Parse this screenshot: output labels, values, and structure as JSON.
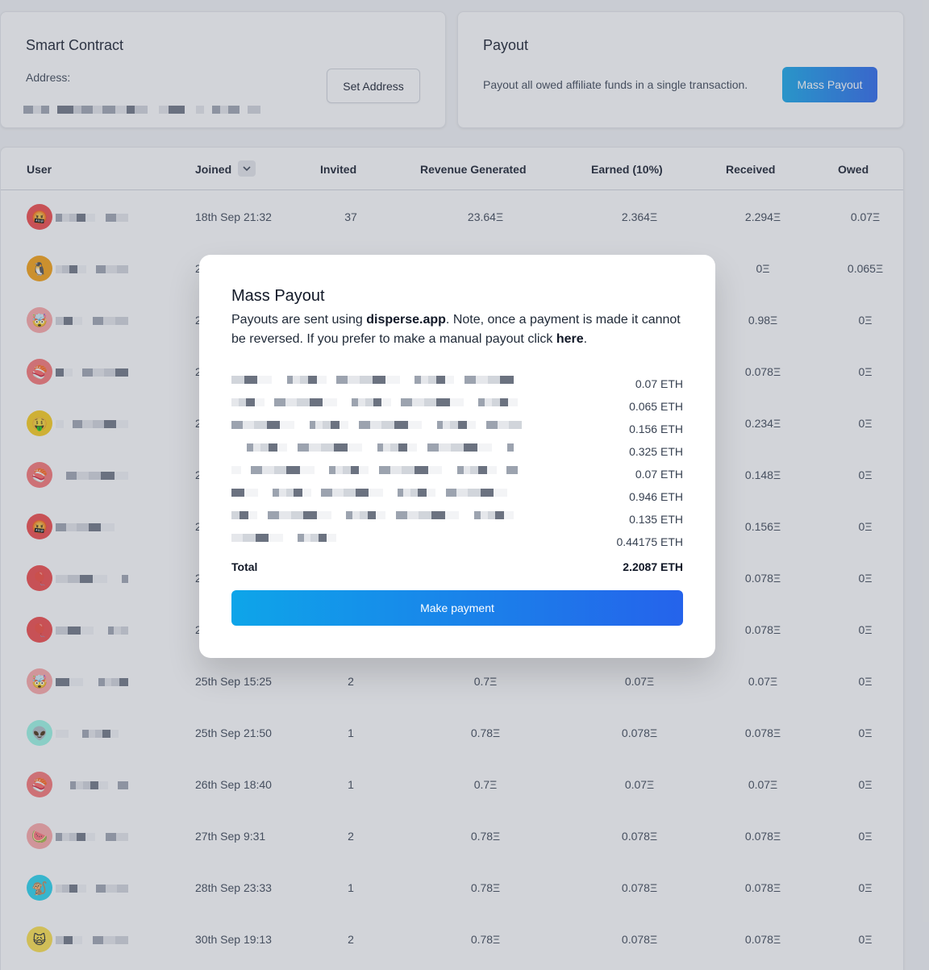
{
  "smart_contract": {
    "title": "Smart Contract",
    "address_label": "Address:",
    "set_address_label": "Set Address"
  },
  "payout": {
    "title": "Payout",
    "description": "Payout all owed affiliate funds in a single transaction.",
    "button_label": "Mass Payout"
  },
  "table": {
    "headers": [
      "User",
      "Joined",
      "Invited",
      "Revenue Generated",
      "Earned (10%)",
      "Received",
      "Owed"
    ],
    "rows": [
      {
        "avatar": "🤬",
        "color": "#ef4444",
        "joined": "18th Sep 21:32",
        "invited": "37",
        "revenue": "23.64Ξ",
        "earned": "2.364Ξ",
        "received": "2.294Ξ",
        "owed": "0.07Ξ"
      },
      {
        "avatar": "🐧",
        "color": "#f59e0b",
        "joined": "2",
        "invited": "",
        "revenue": "",
        "earned": "",
        "received": "0Ξ",
        "owed": "0.065Ξ"
      },
      {
        "avatar": "🤯",
        "color": "#fca5a5",
        "joined": "2",
        "invited": "",
        "revenue": "",
        "earned": "",
        "received": "0.98Ξ",
        "owed": "0Ξ"
      },
      {
        "avatar": "🍣",
        "color": "#f87171",
        "joined": "2",
        "invited": "",
        "revenue": "",
        "earned": "",
        "received": "0.078Ξ",
        "owed": "0Ξ"
      },
      {
        "avatar": "🤑",
        "color": "#facc15",
        "joined": "2",
        "invited": "",
        "revenue": "",
        "earned": "",
        "received": "0.234Ξ",
        "owed": "0Ξ"
      },
      {
        "avatar": "🍣",
        "color": "#f87171",
        "joined": "2",
        "invited": "",
        "revenue": "",
        "earned": "",
        "received": "0.148Ξ",
        "owed": "0Ξ"
      },
      {
        "avatar": "🤬",
        "color": "#ef4444",
        "joined": "2",
        "invited": "",
        "revenue": "",
        "earned": "",
        "received": "0.156Ξ",
        "owed": "0Ξ"
      },
      {
        "avatar": "🎈",
        "color": "#ef4444",
        "joined": "2",
        "invited": "",
        "revenue": "",
        "earned": "",
        "received": "0.078Ξ",
        "owed": "0Ξ"
      },
      {
        "avatar": "🎈",
        "color": "#ef4444",
        "joined": "2",
        "invited": "",
        "revenue": "",
        "earned": "",
        "received": "0.078Ξ",
        "owed": "0Ξ"
      },
      {
        "avatar": "🤯",
        "color": "#fca5a5",
        "joined": "25th Sep 15:25",
        "invited": "2",
        "revenue": "0.7Ξ",
        "earned": "0.07Ξ",
        "received": "0.07Ξ",
        "owed": "0Ξ"
      },
      {
        "avatar": "👽",
        "color": "#99f6e4",
        "joined": "25th Sep 21:50",
        "invited": "1",
        "revenue": "0.78Ξ",
        "earned": "0.078Ξ",
        "received": "0.078Ξ",
        "owed": "0Ξ"
      },
      {
        "avatar": "🍣",
        "color": "#f87171",
        "joined": "26th Sep 18:40",
        "invited": "1",
        "revenue": "0.7Ξ",
        "earned": "0.07Ξ",
        "received": "0.07Ξ",
        "owed": "0Ξ"
      },
      {
        "avatar": "🍉",
        "color": "#fca5a5",
        "joined": "27th Sep 9:31",
        "invited": "2",
        "revenue": "0.78Ξ",
        "earned": "0.078Ξ",
        "received": "0.078Ξ",
        "owed": "0Ξ"
      },
      {
        "avatar": "🐒",
        "color": "#22d3ee",
        "joined": "28th Sep 23:33",
        "invited": "1",
        "revenue": "0.78Ξ",
        "earned": "0.078Ξ",
        "received": "0.078Ξ",
        "owed": "0Ξ"
      },
      {
        "avatar": "🙀",
        "color": "#fde047",
        "joined": "30th Sep 19:13",
        "invited": "2",
        "revenue": "0.78Ξ",
        "earned": "0.078Ξ",
        "received": "0.078Ξ",
        "owed": "0Ξ"
      }
    ]
  },
  "modal": {
    "title": "Mass Payout",
    "desc_prefix": "Payouts are sent using ",
    "desc_link": "disperse.app",
    "desc_mid": ". Note, once a payment is made it cannot be reversed. If you prefer to make a manual payout click ",
    "desc_here": "here",
    "desc_end": ".",
    "payments": [
      "0.07 ETH",
      "0.065 ETH",
      "0.156 ETH",
      "0.325 ETH",
      "0.07 ETH",
      "0.946 ETH",
      "0.135 ETH",
      "0.44175 ETH"
    ],
    "total_label": "Total",
    "total_value": "2.2087 ETH",
    "button_label": "Make payment"
  }
}
